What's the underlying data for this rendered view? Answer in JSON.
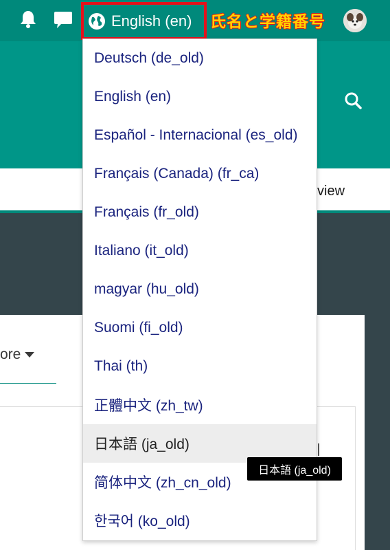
{
  "navbar": {
    "bell_icon": "bell-icon",
    "messages_icon": "chat-bubble-icon",
    "language_icon": "globe-icon",
    "language_label": "English (en)",
    "user_name_overlay": "氏名と学籍番号",
    "colors": {
      "navbar": "#00897b",
      "highlight_box": "#e4111b",
      "overlay_text": "#ffd400"
    }
  },
  "header": {
    "search_icon": "search-icon"
  },
  "tabs": {
    "partial_label": "view"
  },
  "content": {
    "more_tab_label": "ore"
  },
  "language_menu": {
    "items": [
      {
        "label": "Deutsch (de_old)"
      },
      {
        "label": "English (en)"
      },
      {
        "label": "Español - Internacional (es_old)"
      },
      {
        "label": "Français (Canada) (fr_ca)"
      },
      {
        "label": "Français (fr_old)"
      },
      {
        "label": "Italiano (it_old)"
      },
      {
        "label": "magyar (hu_old)"
      },
      {
        "label": "Suomi (fi_old)"
      },
      {
        "label": "Thai (th)"
      },
      {
        "label": "正體中文 (zh_tw)"
      },
      {
        "label": "日本語 (ja_old)",
        "hovered": true
      },
      {
        "label": "简体中文 (zh_cn_old)"
      },
      {
        "label": "한국어 (ko_old)"
      }
    ],
    "link_color": "#1a237e",
    "hover_background": "#ededed"
  },
  "tooltip": {
    "text": "日本語 (ja_old)"
  }
}
